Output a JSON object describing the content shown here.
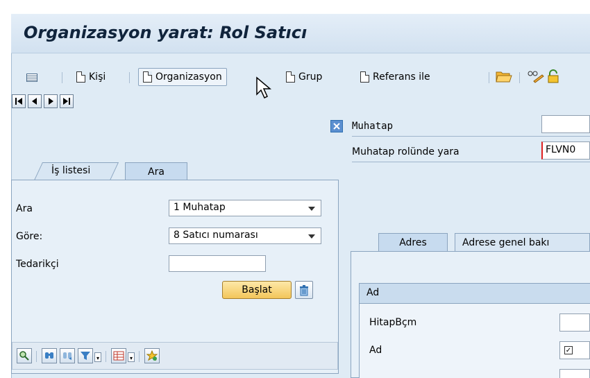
{
  "window": {
    "title": "Organizasyon yarat: Rol Satıcı"
  },
  "toolbar": {
    "buttons": [
      {
        "label": "Kişi",
        "icon": "document-icon"
      },
      {
        "label": "Organizasyon",
        "icon": "document-icon"
      },
      {
        "label": "Grup",
        "icon": "document-icon"
      },
      {
        "label": "Referans ile",
        "icon": "document-icon"
      }
    ]
  },
  "left": {
    "tabs": [
      {
        "label": "İş listesi"
      },
      {
        "label": "Ara"
      }
    ],
    "search": {
      "rows": [
        {
          "label": "Ara",
          "value": "1 Muhatap"
        },
        {
          "label": "Göre:",
          "value": "8 Satıcı numarası"
        },
        {
          "label": "Tedarikçi",
          "value": ""
        }
      ],
      "start_button": "Başlat"
    }
  },
  "right": {
    "muhatap_label": "Muhatap",
    "rol_label": "Muhatap rolünde yara",
    "rol_value": "FLVN0",
    "tabs": [
      {
        "label": "Adres"
      },
      {
        "label": "Adrese genel bakı"
      }
    ],
    "section_title": "Ad",
    "fields": [
      {
        "label": "HitapBçm"
      },
      {
        "label": "Ad"
      }
    ]
  }
}
